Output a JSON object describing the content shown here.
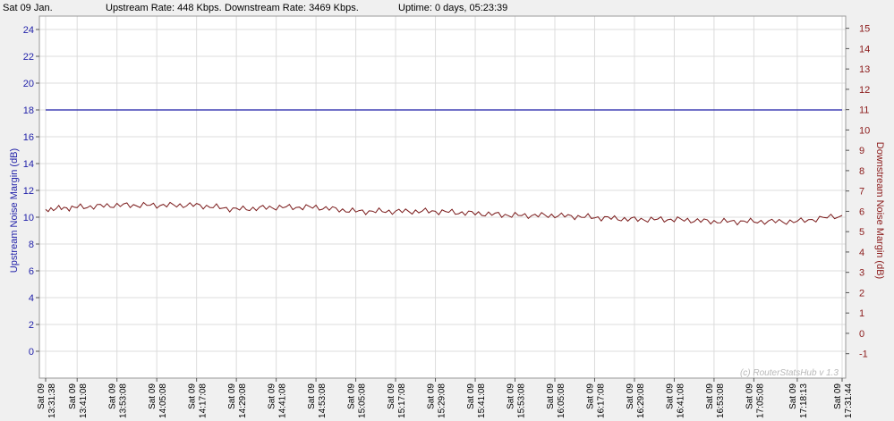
{
  "header": {
    "date": "Sat 09 Jan.",
    "upstream_rate": "Upstream Rate: 448 Kbps.",
    "downstream_rate": "Downstream Rate: 3469 Kbps.",
    "uptime": "Uptime: 0 days, 05:23:39"
  },
  "watermark": "(c) RouterStatsHub v 1.3",
  "colors": {
    "upstream": "#1f1fa8",
    "downstream": "#7a1a1a",
    "grid": "#dcdcdc",
    "plot_bg": "#ffffff",
    "page_bg": "#f0f0f0"
  },
  "chart_data": {
    "type": "line",
    "y_left": {
      "label": "Upstream Noise Margin (dB)",
      "min": -2,
      "max": 25,
      "ticks": [
        0,
        2,
        4,
        6,
        8,
        10,
        12,
        14,
        16,
        18,
        20,
        22,
        24
      ]
    },
    "y_right": {
      "label": "Downstream Noise Margin (dB)",
      "min": -2.2,
      "max": 15.6,
      "ticks": [
        -1,
        0,
        1,
        2,
        3,
        4,
        5,
        6,
        7,
        8,
        9,
        10,
        11,
        12,
        13,
        14,
        15
      ]
    },
    "x_range": [
      "13:31:38",
      "17:31:44"
    ],
    "x_ticks": [
      {
        "date": "Sat 09",
        "time": "13:31:38"
      },
      {
        "date": "Sat 09",
        "time": "13:41:08"
      },
      {
        "date": "Sat 09",
        "time": "13:53:08"
      },
      {
        "date": "Sat 09",
        "time": "14:05:08"
      },
      {
        "date": "Sat 09",
        "time": "14:17:08"
      },
      {
        "date": "Sat 09",
        "time": "14:29:08"
      },
      {
        "date": "Sat 09",
        "time": "14:41:08"
      },
      {
        "date": "Sat 09",
        "time": "14:53:08"
      },
      {
        "date": "Sat 09",
        "time": "15:05:08"
      },
      {
        "date": "Sat 09",
        "time": "15:17:08"
      },
      {
        "date": "Sat 09",
        "time": "15:29:08"
      },
      {
        "date": "Sat 09",
        "time": "15:41:08"
      },
      {
        "date": "Sat 09",
        "time": "15:53:08"
      },
      {
        "date": "Sat 09",
        "time": "16:05:08"
      },
      {
        "date": "Sat 09",
        "time": "16:17:08"
      },
      {
        "date": "Sat 09",
        "time": "16:29:08"
      },
      {
        "date": "Sat 09",
        "time": "16:41:08"
      },
      {
        "date": "Sat 09",
        "time": "16:53:08"
      },
      {
        "date": "Sat 09",
        "time": "17:05:08"
      },
      {
        "date": "Sat 09",
        "time": "17:18:13"
      },
      {
        "date": "Sat 09",
        "time": "17:31:44"
      }
    ],
    "grid": true,
    "series": [
      {
        "axis": "left",
        "points": [
          [
            "13:31:38",
            18.0
          ],
          [
            "17:31:44",
            18.0
          ]
        ]
      },
      {
        "axis": "right",
        "points": [
          [
            "13:31:38",
            6.1
          ],
          [
            "13:41:08",
            6.2
          ],
          [
            "13:53:08",
            6.3
          ],
          [
            "14:05:08",
            6.3
          ],
          [
            "14:17:08",
            6.3
          ],
          [
            "14:29:08",
            6.1
          ],
          [
            "14:41:08",
            6.2
          ],
          [
            "14:53:08",
            6.2
          ],
          [
            "15:05:08",
            6.0
          ],
          [
            "15:17:08",
            6.0
          ],
          [
            "15:29:08",
            6.0
          ],
          [
            "15:41:08",
            5.9
          ],
          [
            "15:53:08",
            5.8
          ],
          [
            "16:05:08",
            5.8
          ],
          [
            "16:17:08",
            5.7
          ],
          [
            "16:29:08",
            5.6
          ],
          [
            "16:41:08",
            5.6
          ],
          [
            "16:53:08",
            5.5
          ],
          [
            "17:05:08",
            5.5
          ],
          [
            "17:18:13",
            5.5
          ],
          [
            "17:31:44",
            5.8
          ]
        ]
      }
    ]
  }
}
